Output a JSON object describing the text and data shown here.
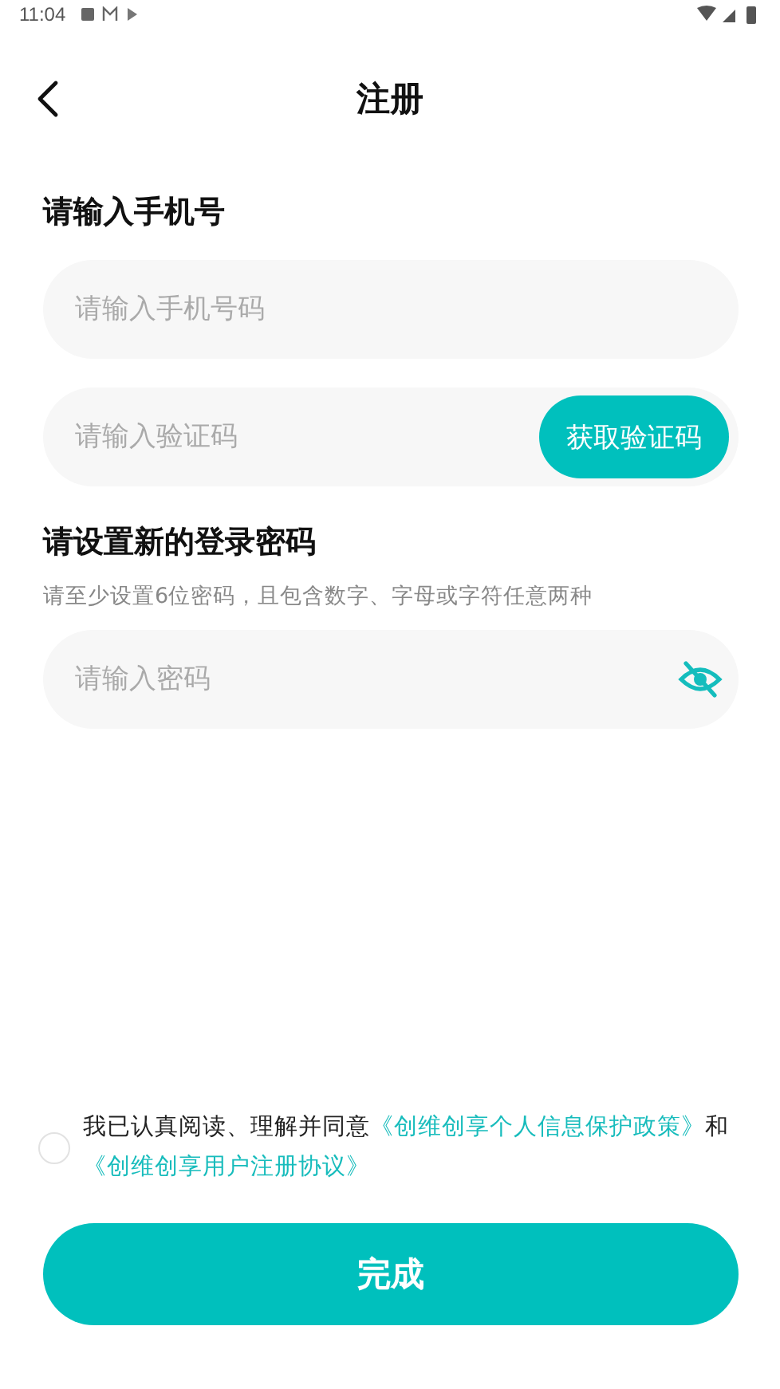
{
  "status_bar": {
    "time": "11:04"
  },
  "header": {
    "title": "注册"
  },
  "phone_section": {
    "title": "请输入手机号",
    "phone_field": {
      "placeholder": "请输入手机号码"
    },
    "code_field": {
      "placeholder": "请输入验证码"
    },
    "code_button": "获取验证码"
  },
  "password_section": {
    "title": "请设置新的登录密码",
    "hint": "请至少设置6位密码，且包含数字、字母或字符任意两种",
    "password_field": {
      "placeholder": "请输入密码",
      "visible": false
    }
  },
  "agreement": {
    "checked": false,
    "parts": [
      {
        "kind": "text",
        "text": "我已认真阅读、理解并同意"
      },
      {
        "kind": "link",
        "text": "《创维创享个人信息保护政策》"
      },
      {
        "kind": "text",
        "text": "和"
      },
      {
        "kind": "link",
        "text": "《创维创享用户注册协议》"
      }
    ]
  },
  "submit_button": "完成"
}
